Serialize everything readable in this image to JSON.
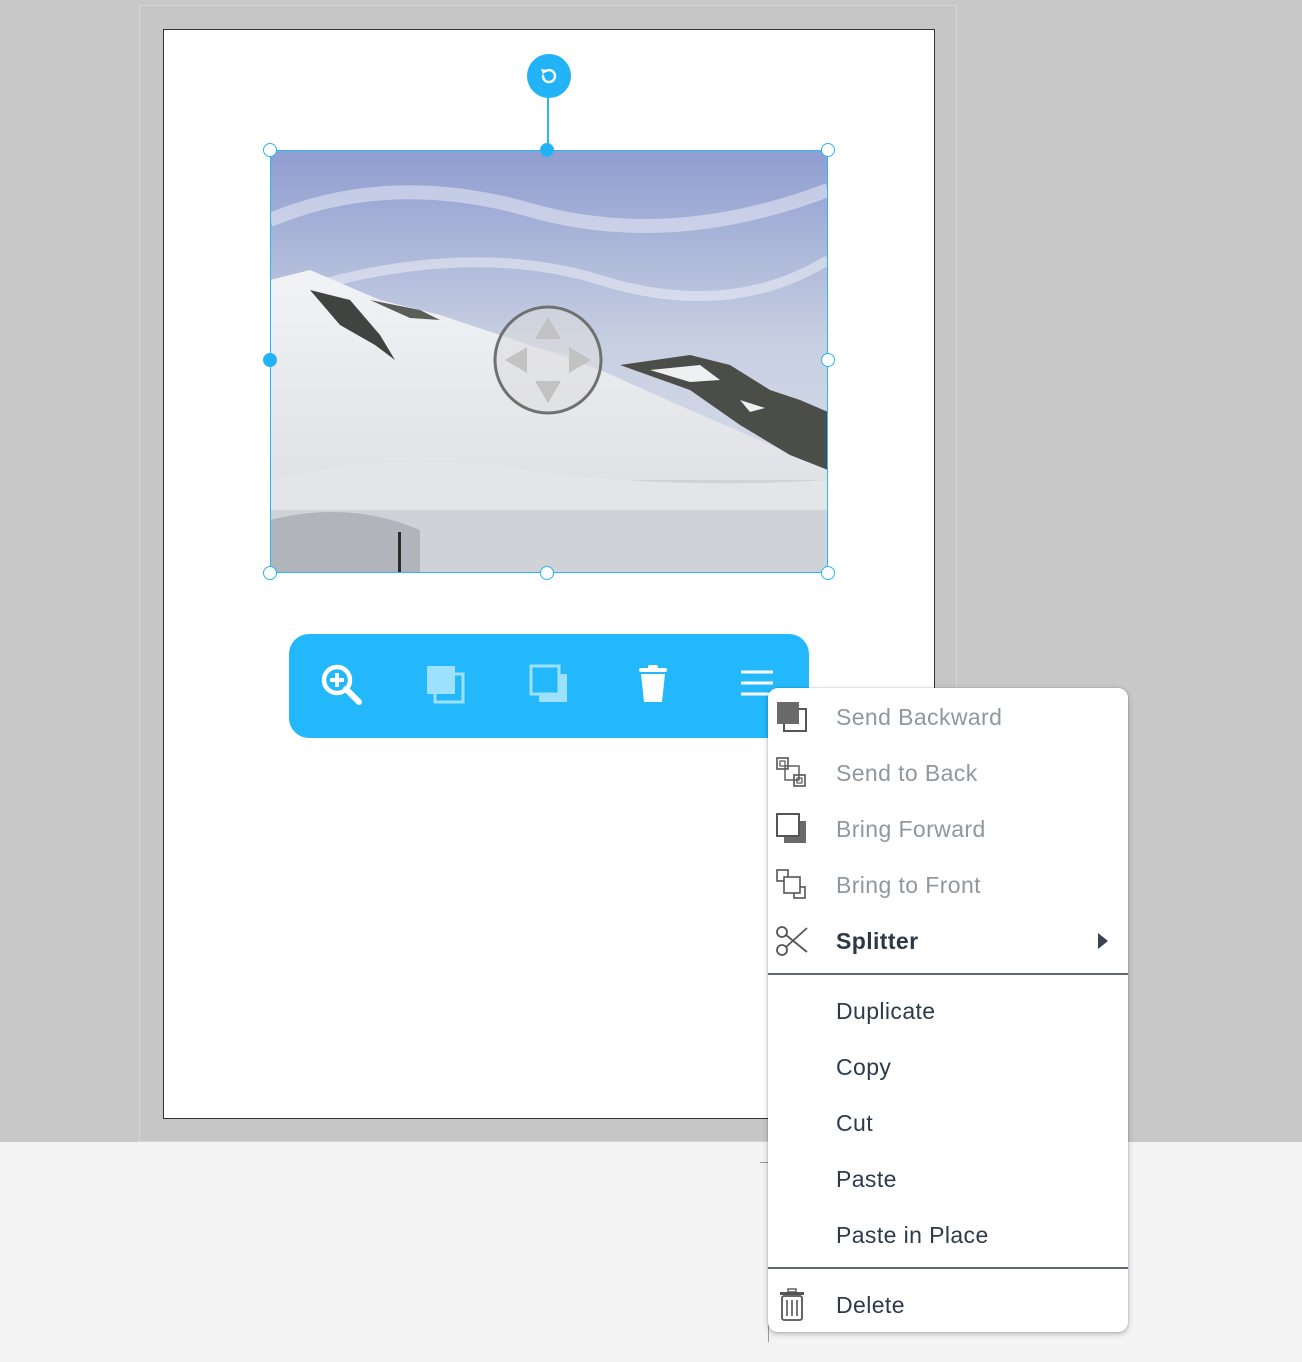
{
  "colors": {
    "accent": "#22b8fb",
    "workspace": "#c8c8c8",
    "menu_text": "#2d3a48",
    "menu_text_disabled": "#8f979f"
  },
  "canvas": {
    "image_name": "snow-mountain-photo"
  },
  "selection": {
    "rotate_icon": "rotate-icon",
    "move_icon": "move-arrows-icon"
  },
  "toolbar": {
    "buttons": [
      {
        "name": "zoom-in",
        "icon": "zoom-in-icon"
      },
      {
        "name": "send-backward",
        "icon": "send-backward-icon"
      },
      {
        "name": "bring-forward",
        "icon": "bring-forward-icon"
      },
      {
        "name": "delete",
        "icon": "trash-icon"
      },
      {
        "name": "menu",
        "icon": "hamburger-icon"
      }
    ]
  },
  "context_menu": {
    "items": [
      {
        "label": "Send Backward",
        "icon": "send-backward-icon",
        "enabled": false
      },
      {
        "label": "Send to Back",
        "icon": "send-to-back-icon",
        "enabled": false
      },
      {
        "label": "Bring Forward",
        "icon": "bring-forward-icon",
        "enabled": false
      },
      {
        "label": "Bring to Front",
        "icon": "bring-to-front-icon",
        "enabled": false
      },
      {
        "label": "Splitter",
        "icon": "scissors-icon",
        "enabled": true,
        "submenu": true
      },
      {
        "label": "Duplicate",
        "enabled": true
      },
      {
        "label": "Copy",
        "enabled": true
      },
      {
        "label": "Cut",
        "enabled": true
      },
      {
        "label": "Paste",
        "enabled": true
      },
      {
        "label": "Paste in Place",
        "enabled": true
      },
      {
        "label": "Delete",
        "icon": "trash-icon",
        "enabled": true
      }
    ]
  }
}
